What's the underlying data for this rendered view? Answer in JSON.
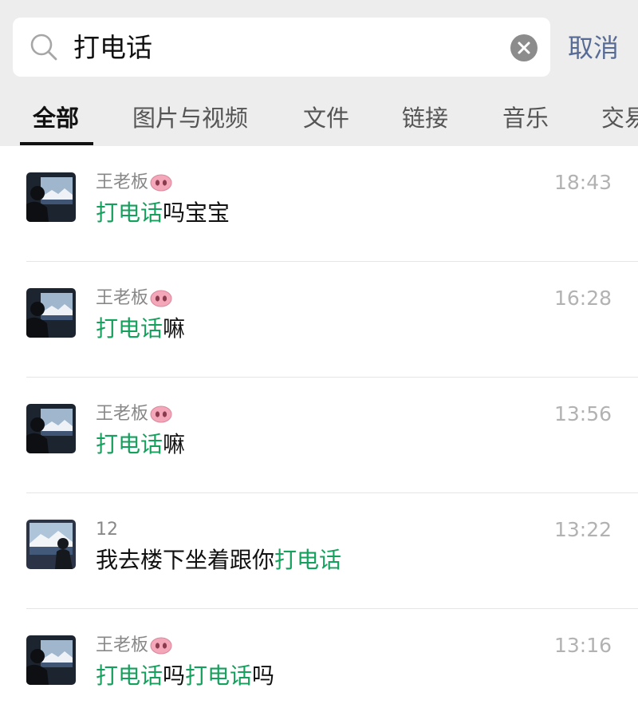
{
  "search": {
    "query": "打电话",
    "cancel_label": "取消"
  },
  "tabs": [
    {
      "label": "全部",
      "active": true
    },
    {
      "label": "图片与视频",
      "active": false
    },
    {
      "label": "文件",
      "active": false
    },
    {
      "label": "链接",
      "active": false
    },
    {
      "label": "音乐",
      "active": false
    },
    {
      "label": "交易",
      "active": false
    }
  ],
  "results": [
    {
      "sender": "王老板",
      "sender_icon": "pig-nose-icon",
      "time": "18:43",
      "message": [
        {
          "text": "打电话",
          "hl": true
        },
        {
          "text": "吗宝宝",
          "hl": false
        }
      ]
    },
    {
      "sender": "王老板",
      "sender_icon": "pig-nose-icon",
      "time": "16:28",
      "message": [
        {
          "text": "打电话",
          "hl": true
        },
        {
          "text": "嘛",
          "hl": false
        }
      ]
    },
    {
      "sender": "王老板",
      "sender_icon": "pig-nose-icon",
      "time": "13:56",
      "message": [
        {
          "text": "打电话",
          "hl": true
        },
        {
          "text": "嘛",
          "hl": false
        }
      ]
    },
    {
      "sender": "12",
      "sender_icon": "",
      "time": "13:22",
      "message": [
        {
          "text": "我去楼下坐着跟你",
          "hl": false
        },
        {
          "text": "打电话",
          "hl": true
        }
      ]
    },
    {
      "sender": "王老板",
      "sender_icon": "pig-nose-icon",
      "time": "13:16",
      "message": [
        {
          "text": "打电话",
          "hl": true
        },
        {
          "text": "吗",
          "hl": false
        },
        {
          "text": "打电话",
          "hl": true
        },
        {
          "text": "吗",
          "hl": false
        }
      ]
    }
  ],
  "colors": {
    "highlight": "#16a05d",
    "cancel": "#576b95",
    "header_bg": "#ededed"
  }
}
